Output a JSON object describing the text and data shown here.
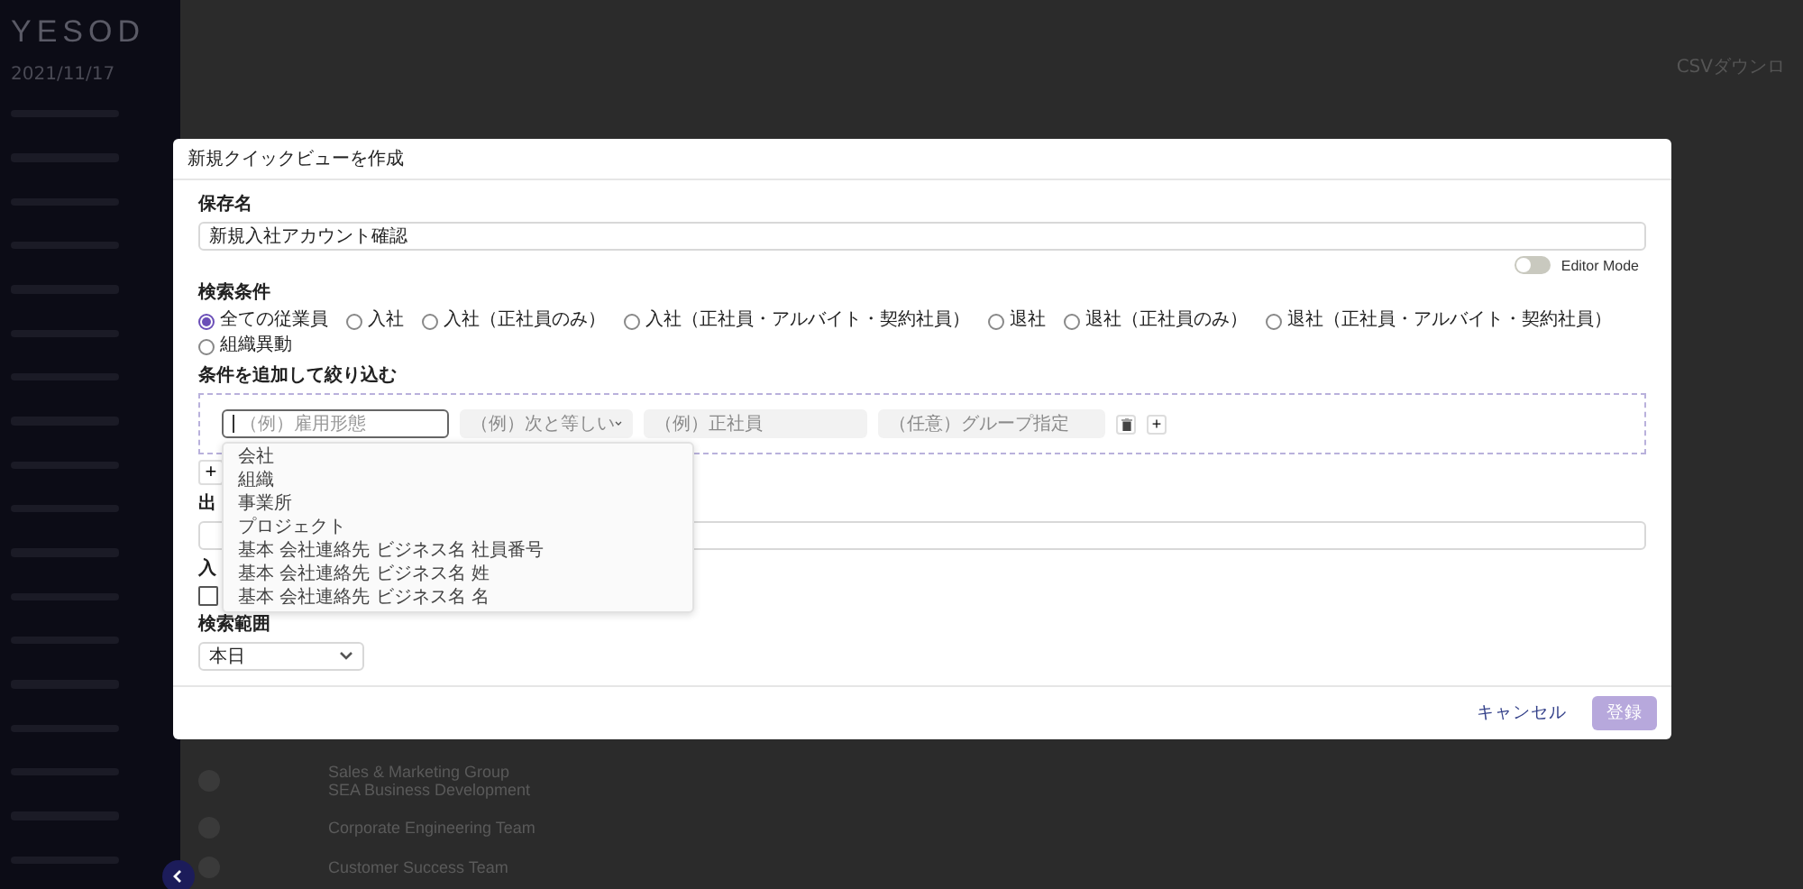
{
  "sidebar": {
    "logo": "YESOD",
    "date": "2021/11/17"
  },
  "toolbar": {
    "download": "CSVダウンロ"
  },
  "background_table": {
    "rows": [
      {
        "team": "Sales & Marketing Group",
        "team_2": "SEA Business Development"
      },
      {
        "team": "Corporate Engineering Team"
      },
      {
        "team": "Customer Success Team"
      }
    ]
  },
  "dialog": {
    "title": "新規クイックビューを作成",
    "save_name": {
      "label": "保存名",
      "value": "新規入社アカウント確認"
    },
    "editor_mode": {
      "label": "Editor Mode",
      "on": false
    },
    "search_condition": {
      "label": "検索条件",
      "options": [
        {
          "label": "全ての従業員",
          "selected": true
        },
        {
          "label": "入社",
          "selected": false
        },
        {
          "label": "入社（正社員のみ）",
          "selected": false
        },
        {
          "label": "入社（正社員・アルバイト・契約社員）",
          "selected": false
        },
        {
          "label": "退社",
          "selected": false
        },
        {
          "label": "退社（正社員のみ）",
          "selected": false
        },
        {
          "label": "退社（正社員・アルバイト・契約社員）",
          "selected": false
        },
        {
          "label": "組織異動",
          "selected": false
        }
      ]
    },
    "filter": {
      "label": "条件を追加して絞り込む",
      "field": {
        "placeholder": "（例）雇用形態"
      },
      "operator": {
        "placeholder": "（例）次と等しい",
        "disabled": true
      },
      "value": {
        "placeholder": "（例）正社員",
        "disabled": true
      },
      "group": {
        "placeholder": "（任意）グループ指定",
        "disabled": true
      },
      "add_button": "+",
      "suggestions": [
        "会社",
        "組織",
        "事業所",
        "プロジェクト",
        "基本 会社連絡先 ビジネス名 社員番号",
        "基本 会社連絡先 ビジネス名 姓",
        "基本 会社連絡先 ビジネス名 名"
      ]
    },
    "add_condition_button": "+",
    "output_label": "出",
    "entry": {
      "label": "入",
      "checked": false
    },
    "range": {
      "label": "検索範囲",
      "value": "本日"
    },
    "cancel": "キャンセル",
    "submit": {
      "label": "登録",
      "disabled": true
    }
  }
}
